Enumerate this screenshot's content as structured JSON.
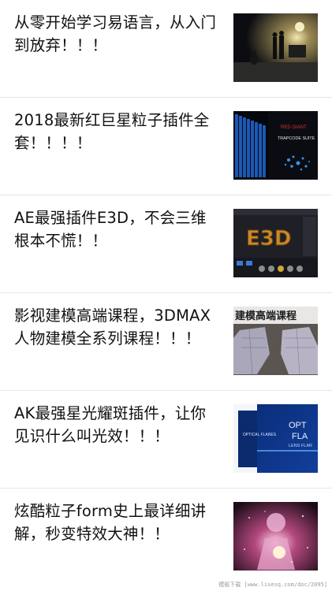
{
  "articles": [
    {
      "title": "从零开始学习易语言，从入门到放弃！！！",
      "thumb_icon": "night-street-image"
    },
    {
      "title": "2018最新红巨星粒子插件全套！！！！",
      "thumb_icon": "trapcode-suite-image",
      "thumb_text": [
        "RED GIANT",
        "TRAPCODE SUITE"
      ]
    },
    {
      "title": "AE最强插件E3D，不会三维根本不慌！！",
      "thumb_icon": "element-3d-image",
      "thumb_text": [
        "E3D"
      ]
    },
    {
      "title": "影视建模高端课程，3DMAX人物建模全系列课程！！！",
      "thumb_icon": "modeling-course-image",
      "thumb_text": [
        "建模高端课程"
      ]
    },
    {
      "title": "AK最强星光耀斑插件，让你见识什么叫光效！！！",
      "thumb_icon": "optical-flares-image",
      "thumb_text": [
        "OPTICAL FLARES",
        "OPT",
        "FLA",
        "LENS FLAR"
      ]
    },
    {
      "title": "炫酷粒子form史上最详细讲解，秒变特效大神！！",
      "thumb_icon": "particle-figure-image"
    }
  ],
  "watermark": "模板下载 [www.lisesq.com/doc/2095]",
  "colors": {
    "text": "#111111",
    "divider": "#e6e6e6"
  }
}
